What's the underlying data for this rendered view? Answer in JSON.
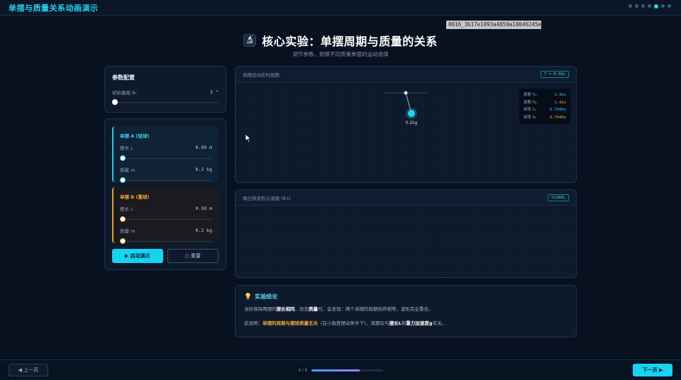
{
  "app": {
    "title": "单摆与质量关系动画演示",
    "nav_dots": [
      false,
      false,
      false,
      false,
      true,
      false,
      false
    ]
  },
  "overlay": {
    "id_tag": "0016_3b17e1093a4859a18046245e"
  },
  "header": {
    "icon": "microscope-icon",
    "icon_glyph": "🔬",
    "title": "核心实验：单摆周期与质量的关系",
    "subtitle": "调节参数，观察不同质量单摆的运动规律"
  },
  "params": {
    "title": "参数配置",
    "angle_label": "初始偏角 θ₀",
    "angle_value": "5 °",
    "angle_fraction": 0
  },
  "pendulum_a": {
    "title": "单摆 A (轻球)",
    "length_label": "摆长 L",
    "length_value": "0.50 m",
    "length_fraction": 0,
    "mass_label": "质量 m",
    "mass_value": "0.2 kg",
    "mass_fraction": 0
  },
  "pendulum_b": {
    "title": "单摆 B (重球)",
    "length_label": "摆长 L",
    "length_value": "0.50 m",
    "length_fraction": 0,
    "mass_label": "质量 m",
    "mass_value": "0.2 kg",
    "mass_fraction": 0
  },
  "controls": {
    "start_label": "▶ 启动演示",
    "reset_label": "○ 重置"
  },
  "simulation": {
    "title": "单摆运动实时视图",
    "badge": "T = 0.00s",
    "bob_mass_label": "0.2kg",
    "stats": [
      {
        "label": "周期",
        "sub": "Tₐ:",
        "value": "1.42s",
        "tone": "a"
      },
      {
        "label": "周期",
        "sub": "Tᵦ:",
        "value": "1.42s",
        "tone": "b"
      },
      {
        "label": "频率",
        "sub": "fₐ:",
        "value": "0.704Hz",
        "tone": "a"
      },
      {
        "label": "频率",
        "sub": "fᵦ:",
        "value": "0.704Hz",
        "tone": "b"
      }
    ]
  },
  "oscilloscope": {
    "title": "角位移波形示波器 (θ-t)",
    "badge": "SIGNAL"
  },
  "conclusion": {
    "title": "实验结论",
    "line1": {
      "p1": "当你保持两摆的",
      "h1": "摆长相同",
      "p2": "，改变",
      "h2": "质量",
      "p3": "时，会发现：两个单摆的周期始终相等，波形完全重合。"
    },
    "line2": {
      "p1": "这说明：",
      "h1": "单摆的周期与摆球质量无关",
      "p2": "（在小角度摆动条件下）。周期仅与",
      "h2": "摆长L",
      "p3": "和",
      "h3": "重力加速度g",
      "p4": "有关。"
    }
  },
  "footer": {
    "prev_label": "◀ 上一页",
    "next_label": "下一页 ▶",
    "page_indicator": "4 / 6",
    "progress_fraction": 0.667
  },
  "colors": {
    "accent": "#17d2f0",
    "pendulum_a": "#26c8e6",
    "pendulum_b": "#e2a126",
    "background": "#08111f"
  }
}
